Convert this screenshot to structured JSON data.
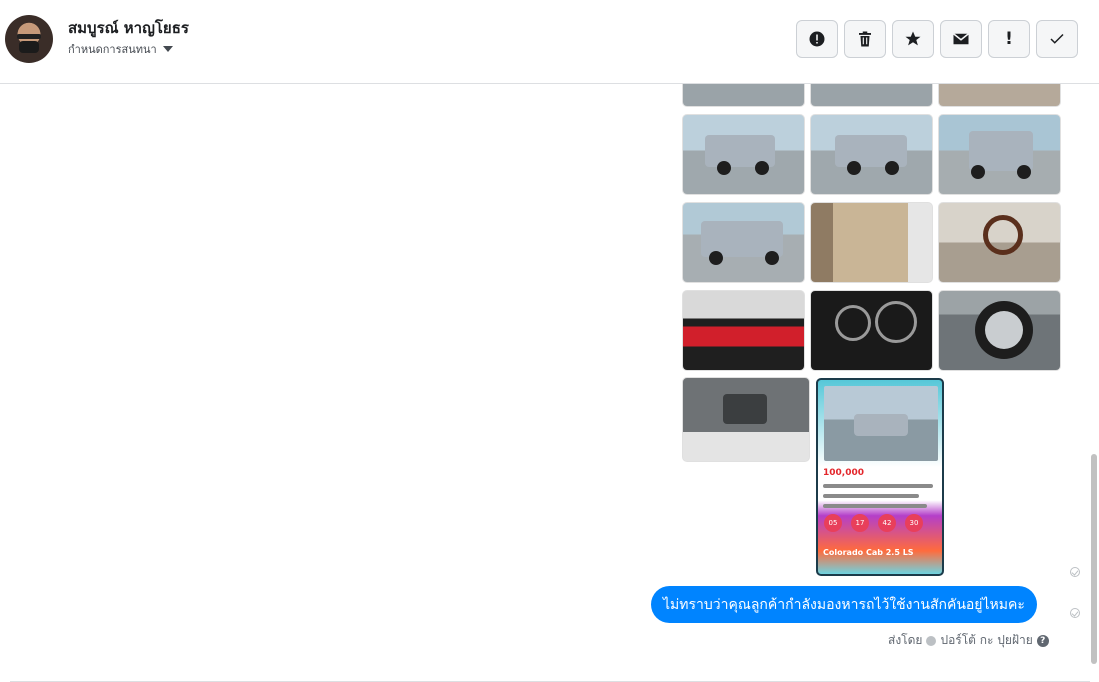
{
  "header": {
    "contact_name": "สมบูรณ์ หาญโยธร",
    "assign_label": "กำหนดการสนทนา",
    "actions": [
      {
        "icon": "spam-icon"
      },
      {
        "icon": "trash-icon"
      },
      {
        "icon": "star-icon"
      },
      {
        "icon": "envelope-icon"
      },
      {
        "icon": "follow-up-icon",
        "glyph": "!"
      },
      {
        "icon": "check-icon"
      }
    ]
  },
  "message": {
    "text": "ไม่ทราบว่าคุณลูกค้ากำลังมองหารถไว้ใช้งานสักคันอยู่ไหมคะ",
    "sent_by_label": "ส่งโดย",
    "sender_name": "ปอร์โต้ กะ ปุยฝ้าย",
    "help_glyph": "?"
  },
  "poster": {
    "price": "100,000",
    "model": "Colorado Cab 2.5 LS",
    "circle_values": [
      "05",
      "17",
      "42",
      "30"
    ]
  },
  "colors": {
    "bubble": "#0084ff",
    "border": "#dddfe2",
    "poster_accent": "#e3262b"
  }
}
